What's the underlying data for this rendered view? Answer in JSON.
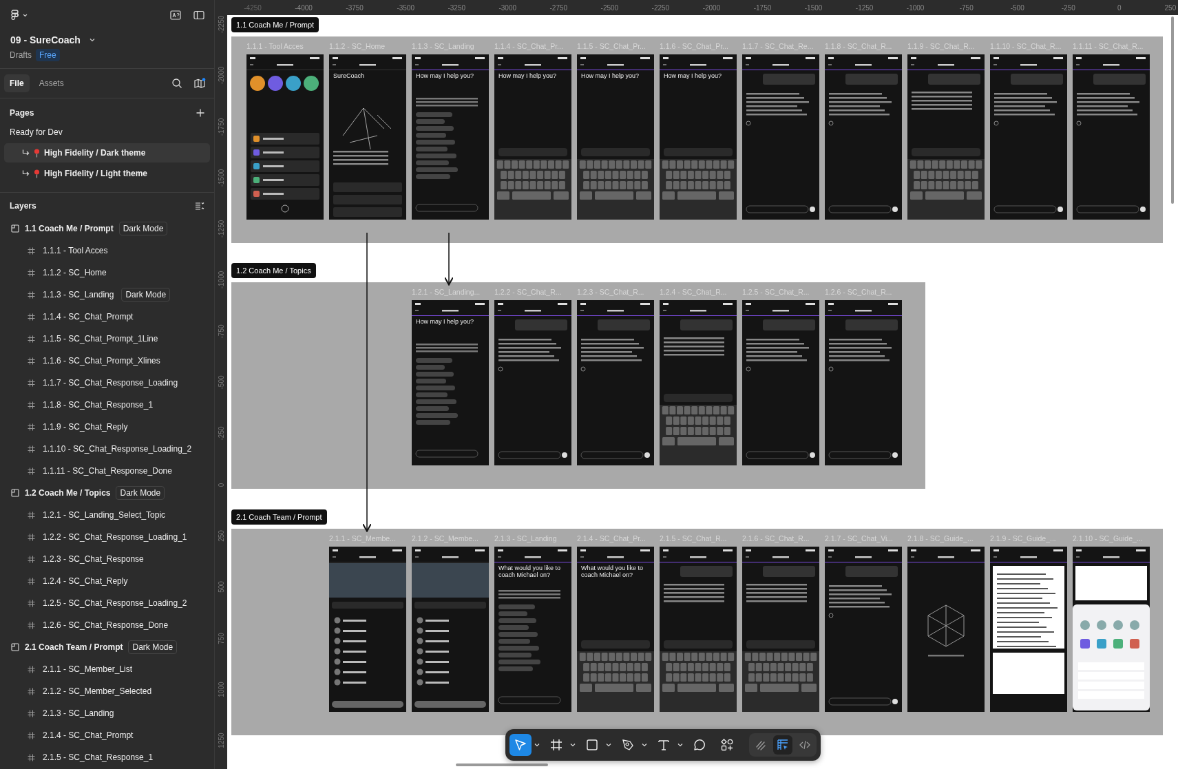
{
  "sidebar": {
    "file_name": "09 - SureCoach",
    "location": "Drafts",
    "plan_badge": "Free",
    "tabs": [
      {
        "label": "File",
        "selected": true
      },
      {
        "label": "Assets",
        "selected": false
      }
    ],
    "pages_title": "Pages",
    "pages": [
      {
        "label": "Ready for Dev",
        "kind": "heading",
        "selected": false
      },
      {
        "label": "High Fidelity / Dark theme",
        "kind": "subpage",
        "selected": true
      },
      {
        "label": "High Fidelity / Light theme",
        "kind": "subpage",
        "selected": false
      }
    ],
    "layers_title": "Layers",
    "layers": [
      {
        "label": "1.1 Coach Me / Prompt",
        "badge": "Dark Mode",
        "children": [
          {
            "label": "1.1.1 - Tool Acces"
          },
          {
            "label": "1.1.2 - SC_Home"
          },
          {
            "label": "1.1.3 - SC_Landing",
            "badge": "Dark Mode"
          },
          {
            "label": "1.1.4 - SC_Chat_Prompt"
          },
          {
            "label": "1.1.5 - SC_Chat_Prompt_1Line"
          },
          {
            "label": "1.1.6 - SC_Chat_Prompt_Xlines"
          },
          {
            "label": "1.1.7 - SC_Chat_Response_Loading"
          },
          {
            "label": "1.1.8 - SC_Chat_Response_1"
          },
          {
            "label": "1.1.9 - SC_Chat_Reply"
          },
          {
            "label": "1.1.10 - SC_Chat_Response_Loading_2"
          },
          {
            "label": "1.1.11 - SC_Chat_Response_Done"
          }
        ]
      },
      {
        "label": "1.2 Coach Me / Topics",
        "badge": "Dark Mode",
        "children": [
          {
            "label": "1.2.1 - SC_Landing_Select_Topic"
          },
          {
            "label": "1.2.2 - SC_Chat_Response_Loading_1"
          },
          {
            "label": "1.2.3 - SC_Chat_Response"
          },
          {
            "label": "1.2.4 - SC_Chat_Reply"
          },
          {
            "label": "1.2.5 - SC_Chat_Response_Loading_2"
          },
          {
            "label": "1.2.6 - SC_Chat_Response_Done"
          }
        ]
      },
      {
        "label": "2.1 Coach Team / Prompt",
        "badge": "Dark Mode",
        "children": [
          {
            "label": "2.1.1 - SC_Member_List"
          },
          {
            "label": "2.1.2 - SC_Member_Selected"
          },
          {
            "label": "2.1.3 - SC_Landing"
          },
          {
            "label": "2.1.4 - SC_Chat_Prompt"
          },
          {
            "label": "2.1.5 - SC_Chat_Response_1"
          }
        ]
      }
    ]
  },
  "ruler": {
    "horizontal": [
      "-4250",
      "-4000",
      "-3750",
      "-3500",
      "-3250",
      "-3000",
      "-2750",
      "-2500",
      "-2250",
      "-2000",
      "-1750",
      "-1500",
      "-1250",
      "-1000",
      "-750",
      "-500",
      "-250",
      "0",
      "250"
    ],
    "vertical": [
      "-2250",
      "-2000",
      "-1750",
      "-1500",
      "-1250",
      "-1000",
      "-750",
      "-500",
      "-250",
      "0",
      "250",
      "500",
      "750",
      "1000",
      "1250"
    ]
  },
  "canvas": {
    "sections": [
      {
        "title": "1.1 Coach Me / Prompt",
        "frames": [
          {
            "label": "1.1.1 - Tool Acces",
            "kind": "menu"
          },
          {
            "label": "1.1.2 - SC_Home",
            "kind": "home",
            "heading": "SureCoach"
          },
          {
            "label": "1.1.3 - SC_Landing",
            "kind": "topics",
            "heading": "How may I help you?"
          },
          {
            "label": "1.1.4 - SC_Chat_Pr...",
            "kind": "keyboard",
            "heading": "How may I help you?"
          },
          {
            "label": "1.1.5 - SC_Chat_Pr...",
            "kind": "keyboard",
            "heading": "How may I help you?"
          },
          {
            "label": "1.1.6 - SC_Chat_Pr...",
            "kind": "keyboard",
            "heading": "How may I help you?"
          },
          {
            "label": "1.1.7 - SC_Chat_Re...",
            "kind": "chat"
          },
          {
            "label": "1.1.8 - SC_Chat_R...",
            "kind": "chat"
          },
          {
            "label": "1.1.9 - SC_Chat_R...",
            "kind": "chat-keyboard"
          },
          {
            "label": "1.1.10 - SC_Chat_R...",
            "kind": "chat"
          },
          {
            "label": "1.1.11 - SC_Chat_R...",
            "kind": "chat"
          }
        ]
      },
      {
        "title": "1.2 Coach Me / Topics",
        "frames": [
          {
            "label": "1.2.1 - SC_Landing...",
            "kind": "topics",
            "heading": "How may I help you?"
          },
          {
            "label": "1.2.2 - SC_Chat_R...",
            "kind": "chat"
          },
          {
            "label": "1.2.3 - SC_Chat_R...",
            "kind": "chat"
          },
          {
            "label": "1.2.4 - SC_Chat_R...",
            "kind": "chat-keyboard"
          },
          {
            "label": "1.2.5 - SC_Chat_R...",
            "kind": "chat"
          },
          {
            "label": "1.2.6 - SC_Chat_R...",
            "kind": "chat"
          }
        ]
      },
      {
        "title": "2.1 Coach Team / Prompt",
        "frames": [
          {
            "label": "2.1.1 - SC_Membe...",
            "kind": "members"
          },
          {
            "label": "2.1.2 - SC_Membe...",
            "kind": "members"
          },
          {
            "label": "2.1.3 - SC_Landing",
            "kind": "topics",
            "heading": "What would you like to coach Michael on?"
          },
          {
            "label": "2.1.4 - SC_Chat_Pr...",
            "kind": "keyboard",
            "heading": "What would you like to coach Michael on?"
          },
          {
            "label": "2.1.5 - SC_Chat_R...",
            "kind": "chat-keyboard"
          },
          {
            "label": "2.1.6 - SC_Chat_R...",
            "kind": "chat-keyboard"
          },
          {
            "label": "2.1.7 - SC_Chat_Vi...",
            "kind": "chat"
          },
          {
            "label": "2.1.8 - SC_Guide_...",
            "kind": "guide"
          },
          {
            "label": "2.1.9 - SC_Guide_...",
            "kind": "document"
          },
          {
            "label": "2.1.10 - SC_Guide_...",
            "kind": "share"
          }
        ]
      }
    ]
  },
  "toolbar": {
    "tools": [
      {
        "kind": "move",
        "selected": true,
        "menu": true
      },
      {
        "kind": "frame",
        "selected": false,
        "menu": true
      },
      {
        "kind": "shape",
        "selected": false,
        "menu": true
      },
      {
        "kind": "pen",
        "selected": false,
        "menu": true
      },
      {
        "kind": "text",
        "selected": false,
        "menu": true
      },
      {
        "kind": "comment",
        "selected": false,
        "menu": false
      },
      {
        "kind": "actions",
        "selected": false,
        "menu": false
      }
    ],
    "modes": [
      {
        "kind": "draw",
        "selected": false
      },
      {
        "kind": "design",
        "selected": true
      },
      {
        "kind": "dev",
        "selected": false
      }
    ]
  }
}
